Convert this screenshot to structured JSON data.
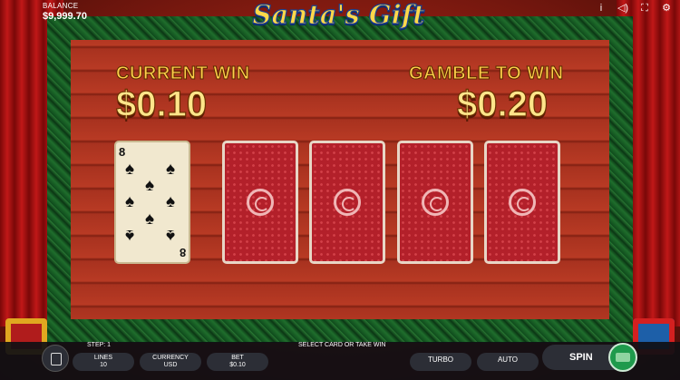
{
  "header": {
    "balance_label": "BALANCE",
    "balance_value": "$9,999.70",
    "logo": "Santa's Gift",
    "icons": [
      "info-icon",
      "sound-icon",
      "fullscreen-icon",
      "settings-icon"
    ],
    "icon_glyphs": [
      "i",
      "◁)",
      "⛶",
      "⚙"
    ]
  },
  "gamble": {
    "current_win_label": "CURRENT WIN",
    "current_win_value": "$0.10",
    "gamble_label": "GAMBLE TO WIN",
    "gamble_value": "$0.20"
  },
  "cards": {
    "dealer": {
      "rank": "8",
      "suit": "♠",
      "suit_name": "spades"
    },
    "face_down_count": 4
  },
  "bottom_bar": {
    "step": "STEP: 1",
    "message": "SELECT CARD OR TAKE WIN",
    "lines_label": "LINES",
    "lines_value": "10",
    "currency_label": "CURRENCY",
    "currency_value": "USD",
    "bet_label": "BET",
    "bet_value": "$0.10",
    "turbo": "TURBO",
    "auto": "AUTO",
    "spin": "SPIN"
  }
}
